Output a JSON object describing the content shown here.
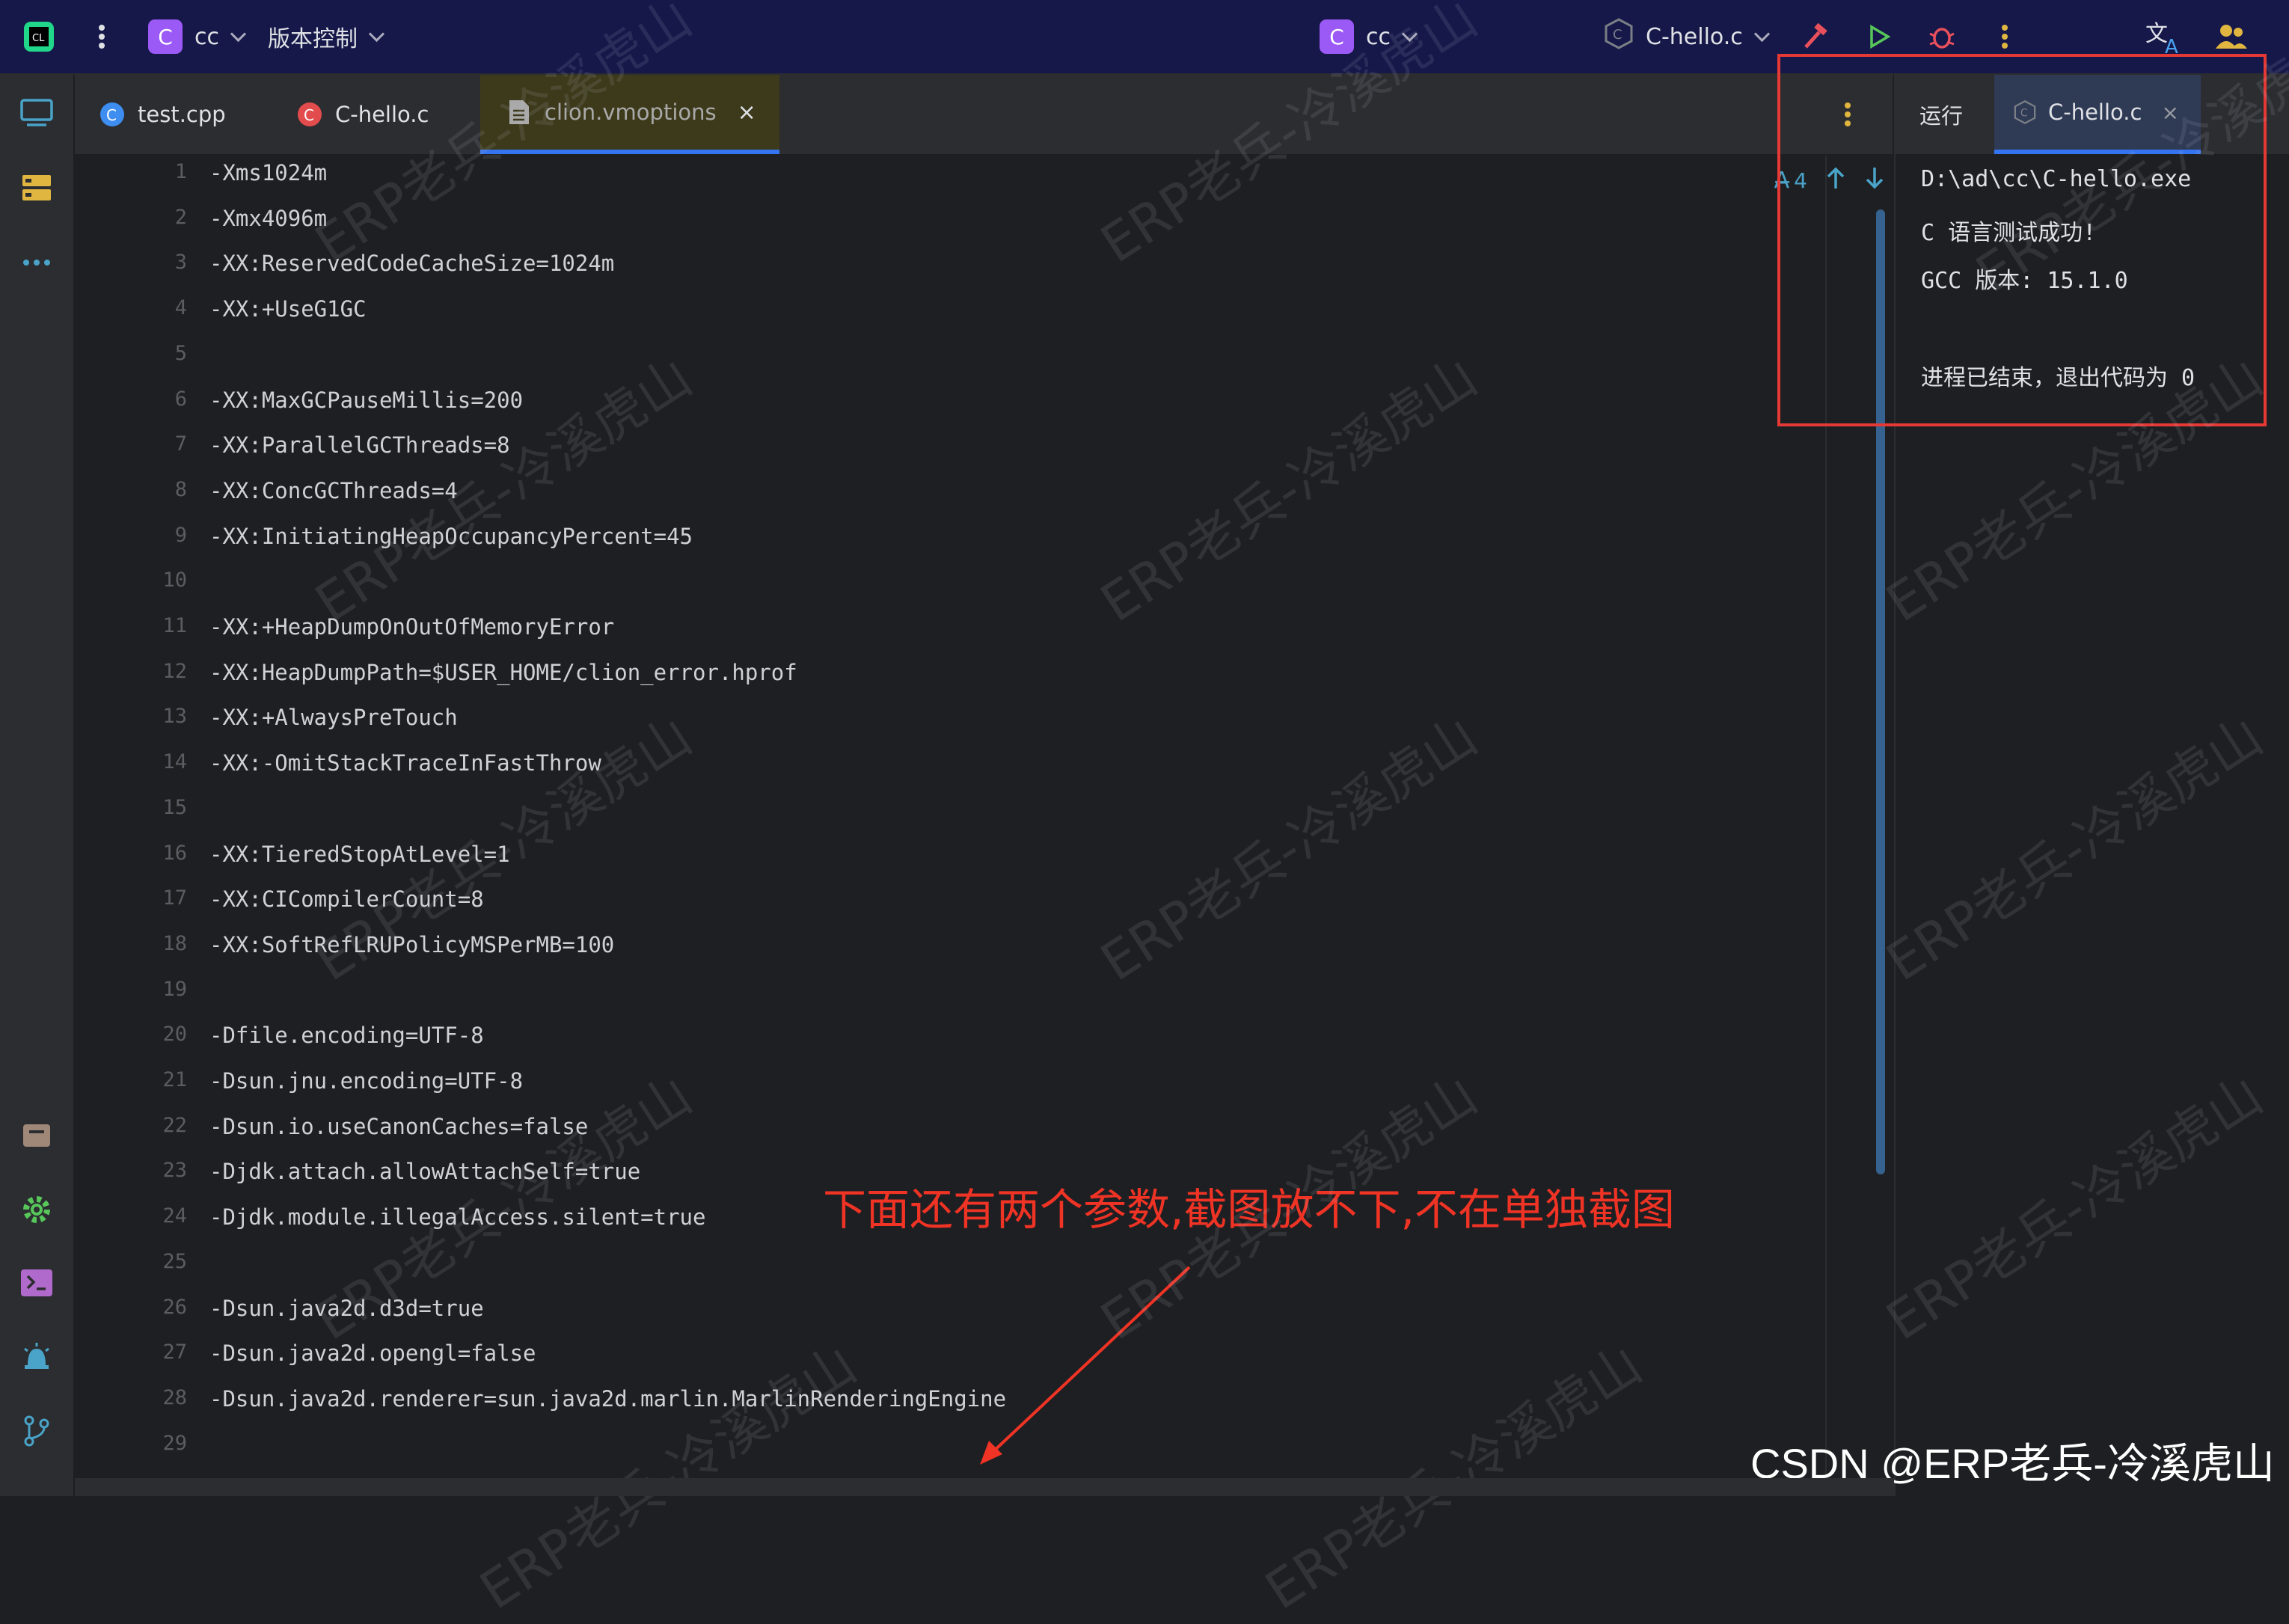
{
  "topbar": {
    "project_badge": "C",
    "project_name": "cc",
    "vcs_label": "版本控制",
    "center_badge": "C",
    "center_name": "cc",
    "run_config": "C-hello.c"
  },
  "tabs": [
    {
      "label": "test.cpp",
      "icon": "cpp-file-icon"
    },
    {
      "label": "C-hello.c",
      "icon": "c-file-icon"
    },
    {
      "label": "clion.vmoptions",
      "icon": "text-file-icon",
      "active": true
    }
  ],
  "editor": {
    "lines": [
      "-Xms1024m",
      "-Xmx4096m",
      "-XX:ReservedCodeCacheSize=1024m",
      "-XX:+UseG1GC",
      "",
      "-XX:MaxGCPauseMillis=200",
      "-XX:ParallelGCThreads=8",
      "-XX:ConcGCThreads=4",
      "-XX:InitiatingHeapOccupancyPercent=45",
      "",
      "-XX:+HeapDumpOnOutOfMemoryError",
      "-XX:HeapDumpPath=$USER_HOME/clion_error.hprof",
      "-XX:+AlwaysPreTouch",
      "-XX:-OmitStackTraceInFastThrow",
      "",
      "-XX:TieredStopAtLevel=1",
      "-XX:CICompilerCount=8",
      "-XX:SoftRefLRUPolicyMSPerMB=100",
      "",
      "-Dfile.encoding=UTF-8",
      "-Dsun.jnu.encoding=UTF-8",
      "-Dsun.io.useCanonCaches=false",
      "-Djdk.attach.allowAttachSelf=true",
      "-Djdk.module.illegalAccess.silent=true",
      "",
      "-Dsun.java2d.d3d=true",
      "-Dsun.java2d.opengl=false",
      "-Dsun.java2d.renderer=sun.java2d.marlin.MarlinRenderingEngine",
      ""
    ],
    "line_numbers": [
      "1",
      "2",
      "3",
      "4",
      "5",
      "6",
      "7",
      "8",
      "9",
      "10",
      "11",
      "12",
      "13",
      "14",
      "15",
      "16",
      "17",
      "18",
      "19",
      "20",
      "21",
      "22",
      "23",
      "24",
      "25",
      "26",
      "27",
      "28",
      "29"
    ],
    "warning_count": "4"
  },
  "run_panel": {
    "title": "运行",
    "tab_label": "C-hello.c",
    "output": [
      "D:\\ad\\cc\\C-hello.exe",
      "C 语言测试成功!",
      "GCC 版本: 15.1.0",
      "",
      "进程已结束，退出代码为 0"
    ]
  },
  "annotation": {
    "text": "下面还有两个参数,截图放不下,不在单独截图"
  },
  "watermark": {
    "text": "ERP老兵-冷溪虎山",
    "csdn": "CSDN @ERP老兵-冷溪虎山"
  },
  "colors": {
    "accent": "#3574f0",
    "annotation_red": "#ef3325",
    "badge_purple": "#9b59f5"
  }
}
